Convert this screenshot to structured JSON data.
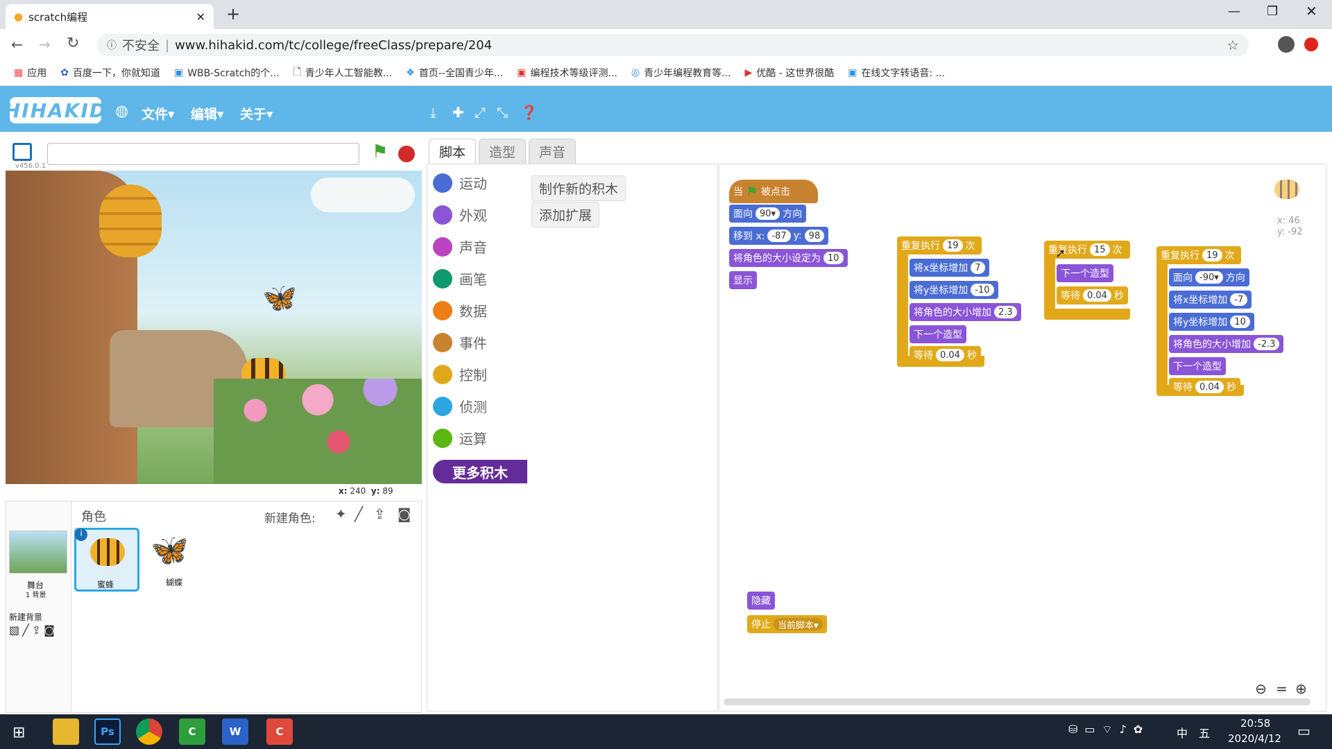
{
  "browser": {
    "tab_title": "scratch编程",
    "new_tab": "+",
    "security": "不安全",
    "url": "www.hihakid.com/tc/college/freeClass/prepare/204",
    "bookmarks": [
      "应用",
      "百度一下，你就知道",
      "WBB-Scratch的个...",
      "青少年人工智能教...",
      "首页--全国青少年...",
      "编程技术等级评测...",
      "青少年编程教育等...",
      "优酷 - 这世界很酷",
      "在线文字转语音: ..."
    ]
  },
  "app": {
    "logo": "HIHAKID",
    "menus": [
      "文件",
      "编辑",
      "关于"
    ],
    "version": "v456.0.1",
    "coords_stage": {
      "x_label": "x:",
      "x": "240",
      "y_label": "y:",
      "y": "89"
    }
  },
  "sprites": {
    "header": "角色",
    "new_sprite": "新建角色:",
    "stage_label": "舞台",
    "backdrop_count": "1 背景",
    "new_backdrop": "新建背景",
    "items": [
      "蜜蜂",
      "蝴蝶"
    ]
  },
  "palette": {
    "tabs": [
      "脚本",
      "造型",
      "声音"
    ],
    "categories": [
      {
        "label": "运动",
        "color": "#4a6cd4"
      },
      {
        "label": "外观",
        "color": "#8a55d7"
      },
      {
        "label": "声音",
        "color": "#bb42c3"
      },
      {
        "label": "画笔",
        "color": "#0e9a6c"
      },
      {
        "label": "数据",
        "color": "#ee7d16"
      },
      {
        "label": "事件",
        "color": "#c88330"
      },
      {
        "label": "控制",
        "color": "#e1a91a"
      },
      {
        "label": "侦测",
        "color": "#2ca5e2"
      },
      {
        "label": "运算",
        "color": "#5cb712"
      }
    ],
    "more_blocks": "更多积木",
    "make_block": "制作新的积木",
    "add_extension": "添加扩展"
  },
  "scripts": {
    "sprite_coords": {
      "x": "x: 46",
      "y": "y: -92"
    },
    "s1": {
      "hat_when": "当",
      "hat_clicked": "被点击",
      "point_label": "面向",
      "point_val": "90▾",
      "point_suffix": "方向",
      "goto_label": "移到 x:",
      "goto_x": "-87",
      "goto_y_label": "y:",
      "goto_y": "98",
      "size_label": "将角色的大小设定为",
      "size_val": "10",
      "show": "显示"
    },
    "s2": {
      "repeat": "重复执行",
      "times": "19",
      "unit": "次",
      "cx_label": "将x坐标增加",
      "cx": "7",
      "cy_label": "将y坐标增加",
      "cy": "-10",
      "size_label": "将角色的大小增加",
      "size": "2.3",
      "next": "下一个造型",
      "wait": "等待",
      "wait_val": "0.04",
      "sec": "秒"
    },
    "s3": {
      "repeat": "重复执行",
      "times": "15",
      "unit": "次",
      "next": "下一个造型",
      "wait": "等待",
      "wait_val": "0.04",
      "sec": "秒"
    },
    "s4": {
      "repeat": "重复执行",
      "times": "19",
      "unit": "次",
      "point_label": "面向",
      "point_val": "-90▾",
      "point_suffix": "方向",
      "cx_label": "将x坐标增加",
      "cx": "-7",
      "cy_label": "将y坐标增加",
      "cy": "10",
      "size_label": "将角色的大小增加",
      "size": "-2.3",
      "next": "下一个造型",
      "wait": "等待",
      "wait_val": "0.04",
      "sec": "秒"
    },
    "s5": {
      "hide": "隐藏",
      "stop": "停止",
      "stop_val": "当前脚本▾"
    }
  },
  "taskbar": {
    "apps": [
      "Ps",
      "W",
      "C"
    ],
    "ime1": "中",
    "ime2": "五",
    "time": "20:58",
    "date": "2020/4/12"
  }
}
